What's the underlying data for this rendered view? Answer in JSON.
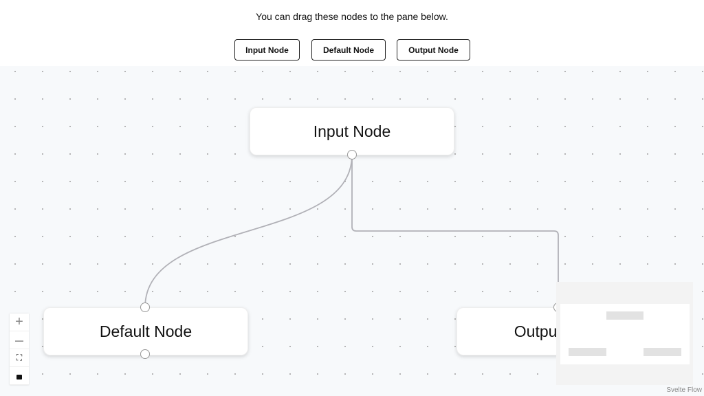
{
  "header": {
    "hint": "You can drag these nodes to the pane below.",
    "buttons": [
      "Input Node",
      "Default Node",
      "Output Node"
    ]
  },
  "nodes": {
    "input": "Input Node",
    "default": "Default Node",
    "output": "Output Node"
  },
  "controls": {
    "zoom_in": "+",
    "zoom_out": "—",
    "fit": "⛶",
    "lock": "🔓"
  },
  "attribution": "Svelte Flow"
}
